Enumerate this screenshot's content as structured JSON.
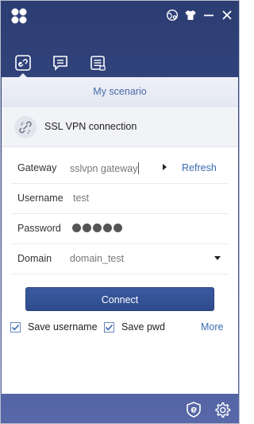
{
  "window": {
    "accent_color": "#2e4b8c",
    "header_color": "#34458a"
  },
  "titlebar": {
    "logo": "app-logo",
    "icons": [
      "globe-settings-icon",
      "shirt-icon",
      "minimize-icon",
      "close-icon"
    ]
  },
  "nav": {
    "icons": [
      "link-icon",
      "message-icon",
      "list-icon"
    ],
    "active_index": 0
  },
  "tabs": {
    "active_label": "My scenario"
  },
  "scenario": {
    "icon": "broken-link-icon",
    "title": "SSL VPN connection"
  },
  "form": {
    "gateway_label": "Gateway",
    "gateway_value": "sslvpn gateway",
    "refresh_label": "Refresh",
    "username_label": "Username",
    "username_value": "test",
    "password_label": "Password",
    "password_dot_count": 5,
    "domain_label": "Domain",
    "domain_value": "domain_test"
  },
  "actions": {
    "connect_label": "Connect",
    "save_username_label": "Save username",
    "save_username_checked": true,
    "save_pwd_label": "Save pwd",
    "save_pwd_checked": true,
    "more_label": "More"
  },
  "footer": {
    "icons": [
      "e-shield-icon",
      "settings-gear-icon"
    ]
  }
}
